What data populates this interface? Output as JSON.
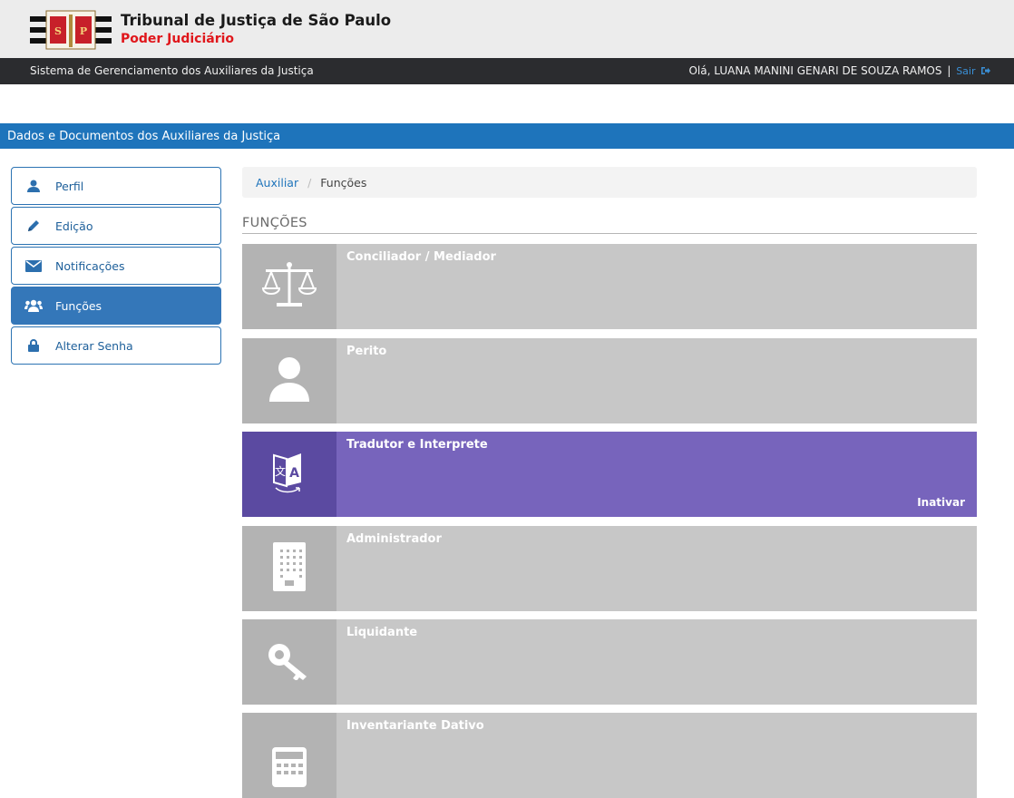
{
  "header": {
    "title": "Tribunal de Justiça de São Paulo",
    "subtitle": "Poder Judiciário",
    "logo_text": "SP"
  },
  "navbar": {
    "system": "Sistema de Gerenciamento dos Auxiliares da Justiça",
    "greeting": "Olá, LUANA MANINI GENARI DE SOUZA RAMOS",
    "separator": "|",
    "logout": "Sair"
  },
  "section": {
    "title": "Dados e Documentos dos Auxiliares da Justiça"
  },
  "sidebar": {
    "items": [
      {
        "label": "Perfil",
        "icon": "user-icon",
        "active": false
      },
      {
        "label": "Edição",
        "icon": "pencil-icon",
        "active": false
      },
      {
        "label": "Notificações",
        "icon": "envelope-icon",
        "active": false
      },
      {
        "label": "Funções",
        "icon": "users-icon",
        "active": true
      },
      {
        "label": "Alterar Senha",
        "icon": "lock-icon",
        "active": false
      }
    ]
  },
  "breadcrumb": {
    "parent": "Auxiliar",
    "separator": "/",
    "current": "Funções"
  },
  "main": {
    "heading": "FUNÇÕES",
    "cards": [
      {
        "label": "Conciliador / Mediador",
        "icon": "scales-icon",
        "active": false,
        "action": ""
      },
      {
        "label": "Perito",
        "icon": "person-icon",
        "active": false,
        "action": ""
      },
      {
        "label": "Tradutor e Interprete",
        "icon": "translate-icon",
        "active": true,
        "action": "Inativar"
      },
      {
        "label": "Administrador",
        "icon": "building-icon",
        "active": false,
        "action": ""
      },
      {
        "label": "Liquidante",
        "icon": "key-icon",
        "active": false,
        "action": ""
      },
      {
        "label": "Inventariante Dativo",
        "icon": "calculator-icon",
        "active": false,
        "action": ""
      }
    ]
  },
  "colors": {
    "primary": "#1e74bb",
    "active_card": "#7764bc",
    "inactive_card": "#c7c7c7",
    "brand_red": "#e0161b"
  }
}
